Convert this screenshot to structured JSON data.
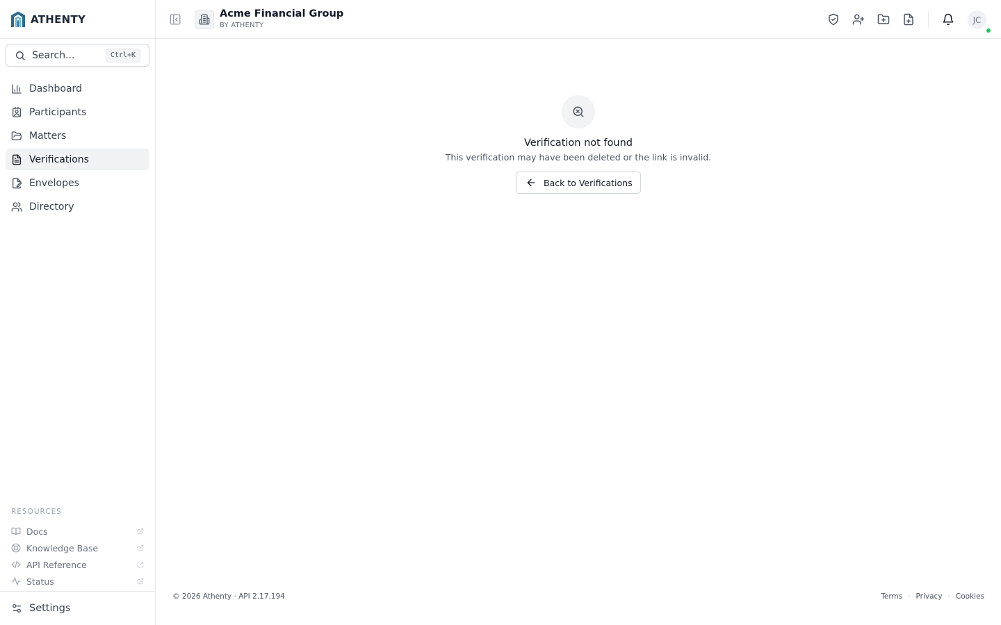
{
  "brand": {
    "name": "ATHENTY"
  },
  "search": {
    "placeholder": "Search...",
    "shortcut": "Ctrl+K"
  },
  "sidebar": {
    "items": [
      {
        "label": "Dashboard",
        "icon": "bar-chart-icon",
        "active": false
      },
      {
        "label": "Participants",
        "icon": "contact-card-icon",
        "active": false
      },
      {
        "label": "Matters",
        "icon": "folder-open-icon",
        "active": false
      },
      {
        "label": "Verifications",
        "icon": "document-icon",
        "active": true
      },
      {
        "label": "Envelopes",
        "icon": "file-signature-icon",
        "active": false
      },
      {
        "label": "Directory",
        "icon": "users-icon",
        "active": false
      }
    ],
    "resources_heading": "RESOURCES",
    "resources": [
      {
        "label": "Docs",
        "icon": "book-icon"
      },
      {
        "label": "Knowledge Base",
        "icon": "lifebuoy-icon"
      },
      {
        "label": "API Reference",
        "icon": "code-icon"
      },
      {
        "label": "Status",
        "icon": "activity-icon"
      }
    ],
    "settings_label": "Settings"
  },
  "header": {
    "org_title": "Acme Financial Group",
    "org_subtitle": "BY ATHENTY",
    "user_initials": "JC",
    "actions": [
      "shield-check-icon",
      "user-plus-icon",
      "folder-plus-icon",
      "file-plus-icon",
      "bell-icon"
    ]
  },
  "main": {
    "empty_title": "Verification not found",
    "empty_description": "This verification may have been deleted or the link is invalid.",
    "back_button_label": "Back to Verifications"
  },
  "footer": {
    "copyright": "© 2026 Athenty · API 2.17.194",
    "links": [
      "Terms",
      "Privacy",
      "Cookies"
    ],
    "separator": "·"
  },
  "colors": {
    "logo_primary": "#2c6a8c",
    "logo_secondary": "#6fb3d2",
    "active_nav_bg": "#f1f2f4",
    "presence": "#22c55e"
  }
}
